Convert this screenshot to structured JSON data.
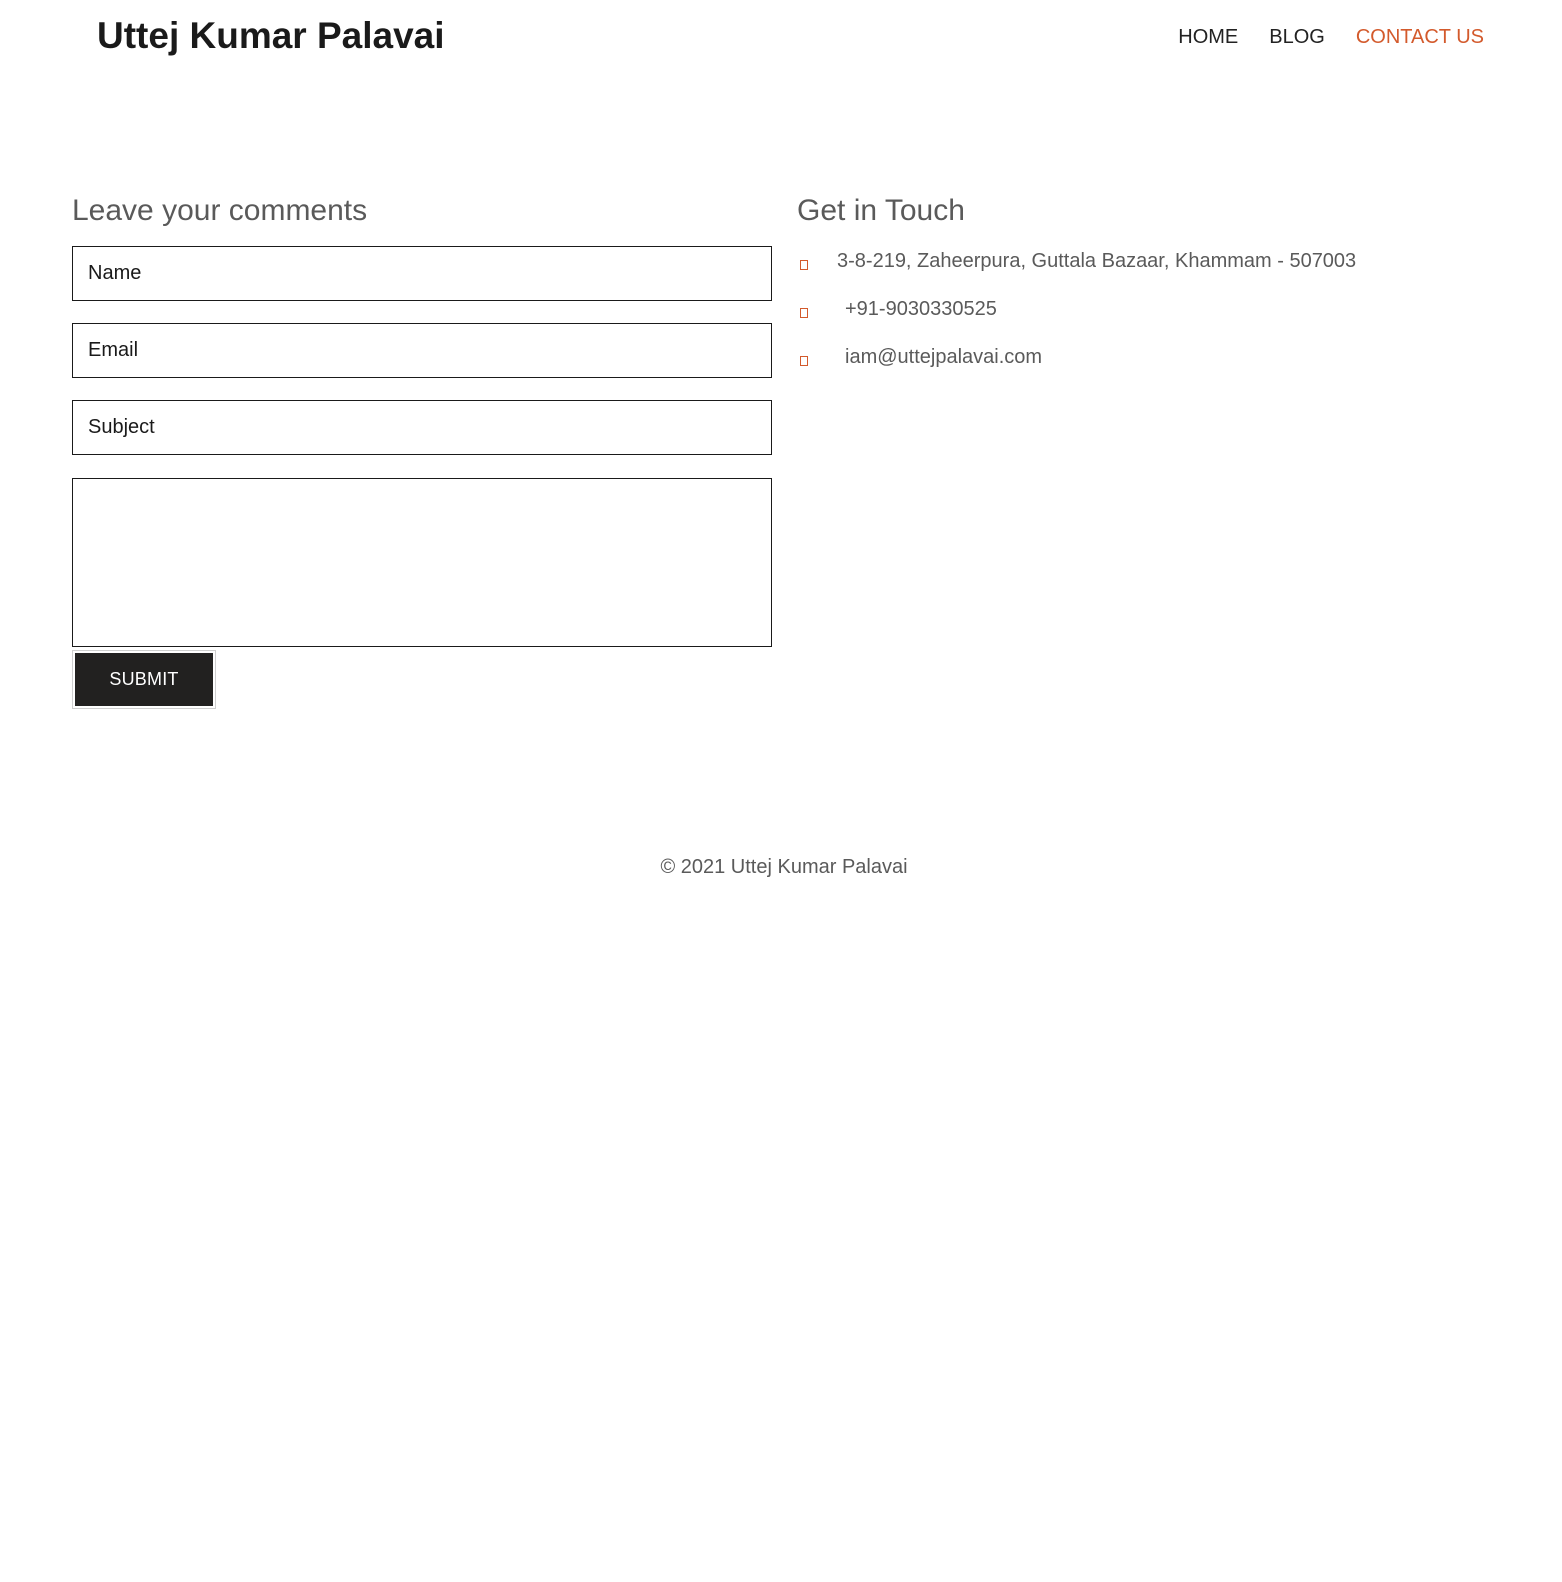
{
  "header": {
    "site_title": "Uttej Kumar Palavai",
    "nav": [
      {
        "label": "HOME",
        "active": false
      },
      {
        "label": "BLOG",
        "active": false
      },
      {
        "label": "CONTACT US",
        "active": true
      }
    ]
  },
  "form": {
    "heading": "Leave your comments",
    "name_placeholder": "Name",
    "email_placeholder": "Email",
    "subject_placeholder": "Subject",
    "message_placeholder": "",
    "submit_label": "SUBMIT"
  },
  "contact": {
    "heading": "Get in Touch",
    "items": [
      {
        "icon": "map-marker-icon",
        "text": "3-8-219, Zaheerpura, Guttala Bazaar, Khammam - 507003"
      },
      {
        "icon": "phone-icon",
        "text": "+91-9030330525"
      },
      {
        "icon": "envelope-icon",
        "text": "iam@uttejpalavai.com"
      }
    ]
  },
  "footer": {
    "copyright": "© 2021 Uttej Kumar Palavai"
  },
  "colors": {
    "accent": "#d35a2c",
    "text_dark": "#1a1a1a",
    "text_muted": "#5a5a5a",
    "button_bg": "#222120"
  }
}
